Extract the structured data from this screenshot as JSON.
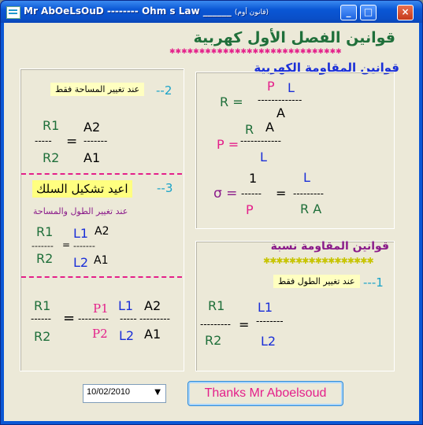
{
  "window": {
    "title": "Mr AbOeLsOuD -------- Ohm s Law ______",
    "title_sub": "(قانون أوم)",
    "buttons": {
      "minimize": "_",
      "maximize": "□",
      "close": "×"
    }
  },
  "header": {
    "main_title": "قوانين الفصل الأول كهربية",
    "stars": "✱✱✱✱✱✱✱✱✱✱✱✱✱✱✱✱✱✱✱✱✱✱✱✱✱✱✱✱✱",
    "resistance_laws_title": "قوانين المقاومة الكهربية"
  },
  "right_top": {
    "R_eq": "R =",
    "P": "P",
    "L": "L",
    "dashes1": "-------------",
    "A": "A",
    "R2": "R",
    "A2": "A",
    "P_eq": "P =",
    "dashes2": "------------",
    "L2": "L",
    "one": "1",
    "L3": "L",
    "sigma_eq": "σ =",
    "dashes3": "------",
    "eq": "=",
    "dashes4": "---------",
    "P3": "P",
    "RA": "R A"
  },
  "right_bottom": {
    "ratio_title": "قوانين المقاومة  نسبة",
    "diamonds": "✱✱✱✱✱✱✱✱✱✱✱✱✱✱✱✱✱",
    "case1_label": "عند تغيير الطول فقط",
    "case1_num": "---1",
    "R1": "R1",
    "dashes_l": "---------",
    "eq": "=",
    "L1": "L1",
    "dashes_r": "--------",
    "R2": "R2",
    "L2": "L2"
  },
  "left_top": {
    "case2_num": "--2",
    "case2_label": "عند تغيير المساحة فقط",
    "R1": "R1",
    "A2": "A2",
    "dashes_l": "-----",
    "eq": "=",
    "dashes_r": "-------",
    "R2": "R2",
    "A1": "A1"
  },
  "left_mid": {
    "case3_num": "--3",
    "case3_label": "اعيد تشكيل السلك",
    "case3_sub": "عند تغيير الطول والمساحة",
    "R1": "R1",
    "L1": "L1",
    "A2": "A2",
    "dashes_l": "-------",
    "eq": "=",
    "dashes_r": "-------",
    "R2": "R2",
    "L2": "L2",
    "A1": "A1"
  },
  "left_bottom": {
    "R1": "R1",
    "P1": "P1",
    "L1": "L1",
    "A2": "A2",
    "dashes_a": "------",
    "eq": "=",
    "dashes_b": "---------",
    "dashes_c": "-----",
    "dashes_d": "---------",
    "R2": "R2",
    "P2": "P2",
    "L2": "L2",
    "A1": "A1"
  },
  "footer": {
    "date_value": "10/02/2010",
    "thanks_label": "Thanks Mr Aboelsoud"
  },
  "colors": {
    "darkgreen": "#1f6f3a",
    "blue": "#1a2fd8",
    "magenta": "#e41f8a",
    "purple": "#8a1a8a",
    "teal": "#1aa3c8"
  }
}
